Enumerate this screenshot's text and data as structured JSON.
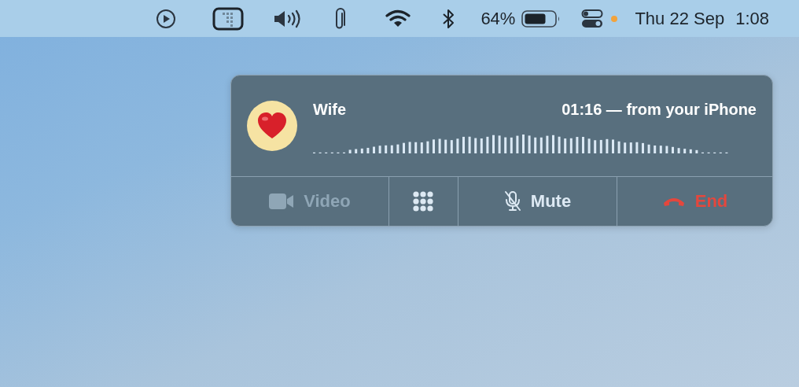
{
  "menu_bar": {
    "battery_percent": "64%",
    "mic_indicator": true,
    "date": "Thu 22 Sep",
    "time": "1:08"
  },
  "call": {
    "caller": "Wife",
    "status": "01:16 — from your iPhone",
    "buttons": [
      {
        "kind": "video",
        "label": "Video",
        "disabled": true
      },
      {
        "kind": "keypad",
        "disabled": false
      },
      {
        "kind": "mute",
        "label": "Mute",
        "disabled": false
      },
      {
        "kind": "end",
        "label": "End",
        "disabled": false
      }
    ]
  }
}
